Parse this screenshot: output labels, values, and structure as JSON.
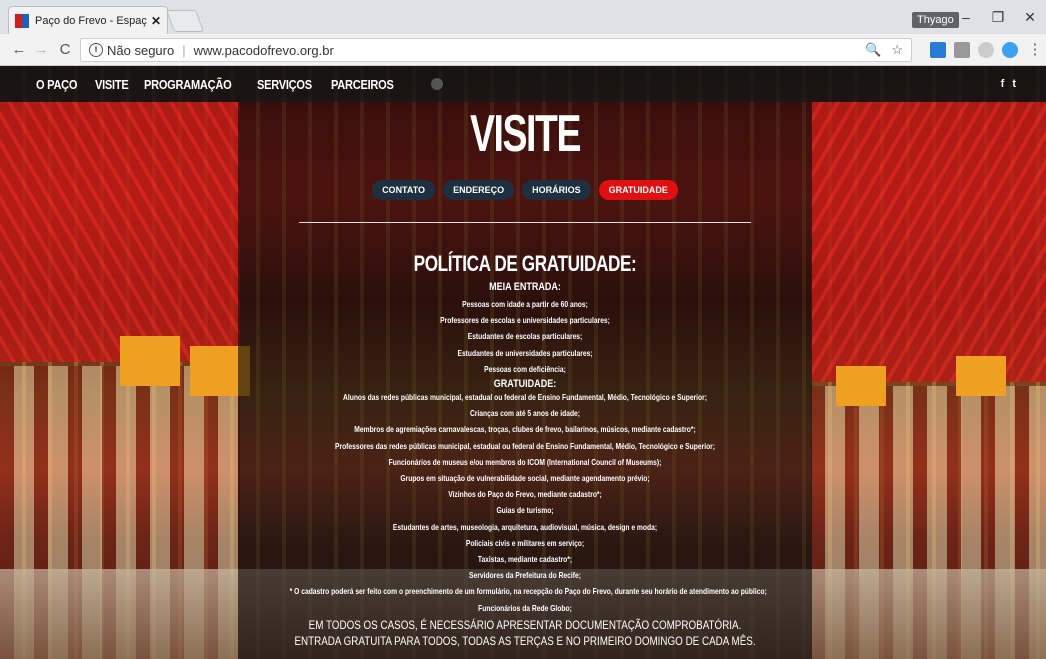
{
  "browser": {
    "tab_title": "Paço do Frevo - Espaço d",
    "tab_close": "✕",
    "profile": "Thyago",
    "win_min": "–",
    "win_max": "❐",
    "win_close": "✕",
    "back": "←",
    "forward": "→",
    "reload": "C",
    "security_label": "Não seguro",
    "url": "www.pacodofrevo.org.br",
    "zoom_icon": "🔍",
    "star_icon": "☆",
    "menu_icon": "⋮"
  },
  "site": {
    "nav": [
      "O PAÇO",
      "VISITE",
      "PROGRAMAÇÃO",
      "SERVIÇOS",
      "PARCEIROS"
    ],
    "social": [
      "f",
      "t"
    ],
    "headline": "VISITE",
    "tabs": [
      {
        "label": "CONTATO",
        "active": false
      },
      {
        "label": "ENDEREÇO",
        "active": false
      },
      {
        "label": "HORÁRIOS",
        "active": false
      },
      {
        "label": "GRATUIDADE",
        "active": true
      }
    ],
    "policy_title": "POLÍTICA DE GRATUIDADE:",
    "meia_title": "MEIA ENTRADA:",
    "meia_items": [
      "Pessoas com idade a partir de 60 anos;",
      "Professores de escolas e universidades particulares;",
      "Estudantes de escolas particulares;",
      "Estudantes de universidades particulares;",
      "Pessoas com deficiência;"
    ],
    "gratuidade_title": "GRATUIDADE:",
    "gratuidade_items": [
      "Alunos das redes públicas municipal, estadual ou federal de Ensino Fundamental, Médio, Tecnológico e Superior;",
      "Crianças com até 5 anos de idade;",
      "Membros de agremiações carnavalescas, troças, clubes de frevo, bailarinos, músicos, mediante cadastro*;",
      "Professores das redes públicas municipal, estadual ou federal de Ensino Fundamental, Médio, Tecnológico e Superior;",
      "Funcionários de museus e/ou membros do ICOM (International Council of Museums);",
      "Grupos em situação de vulnerabilidade social, mediante agendamento prévio;",
      "Vizinhos do Paço do Frevo, mediante cadastro*;",
      "Guias de turismo;",
      "Estudantes de artes, museologia, arquitetura, audiovisual, música, design e moda;",
      "Policiais civis e militares em serviço;",
      "Taxistas, mediante cadastro*;",
      "Servidores da Prefeitura do Recife;",
      "* O cadastro poderá ser feito com o preenchimento de um formulário, na recepção do Paço do Frevo, durante seu horário de atendimento ao público;",
      "Funcionários da Rede Globo;"
    ],
    "note_1": "EM TODOS OS CASOS, É NECESSÁRIO APRESENTAR DOCUMENTAÇÃO COMPROBATÓRIA.",
    "note_2": "ENTRADA GRATUITA PARA TODOS, TODAS AS TERÇAS E NO PRIMEIRO DOMINGO DE CADA MÊS."
  },
  "colors": {
    "active_tab": "#e01010",
    "tab_bg": "#1c3040"
  }
}
